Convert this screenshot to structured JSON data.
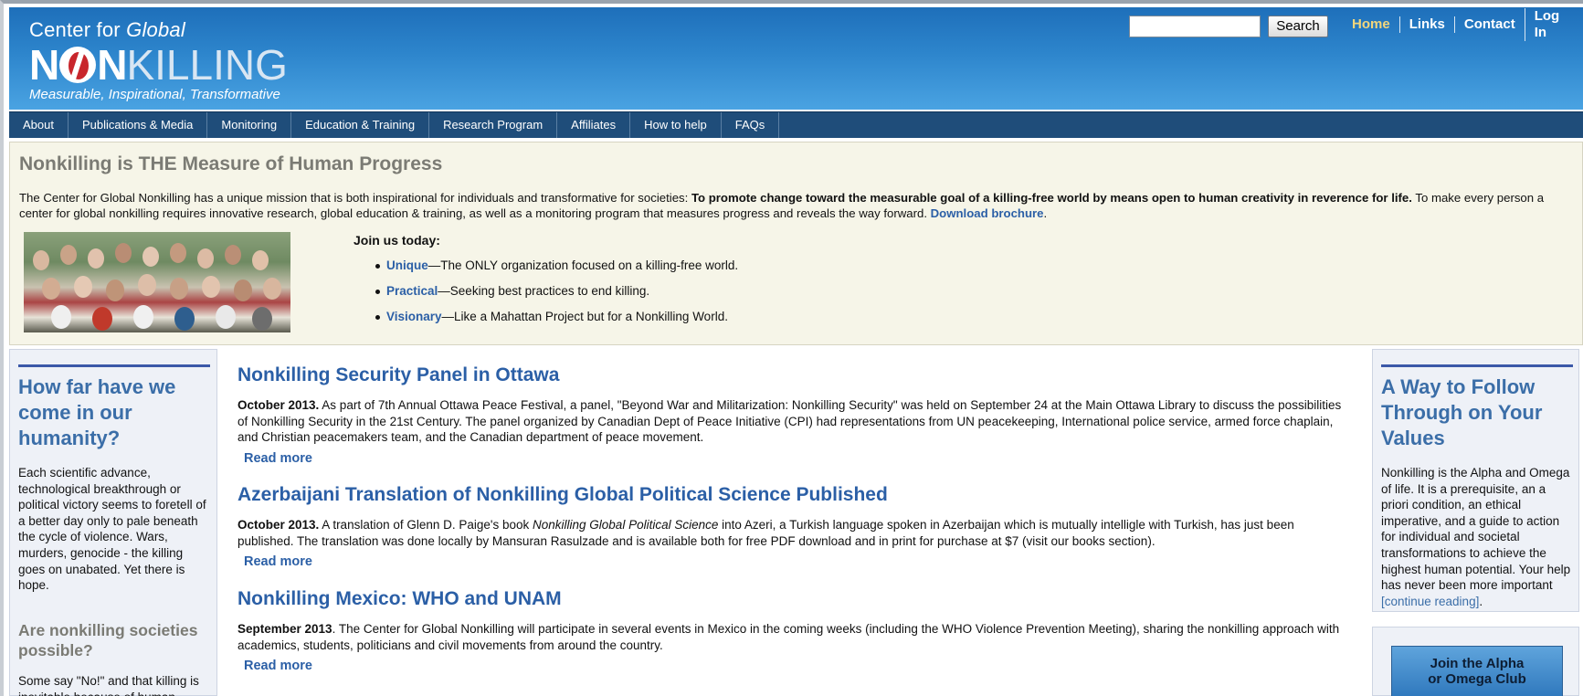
{
  "header": {
    "logo": {
      "top": "Center for ",
      "top_italic": "Global",
      "word_start": "N",
      "word_mid": "N",
      "word_end": "KILLING",
      "tagline": "Measurable, Inspirational, Transformative"
    },
    "search_button": "Search",
    "search_value": "",
    "links": [
      "Home",
      "Links",
      "Contact",
      "Log In"
    ]
  },
  "nav": [
    "About",
    "Publications & Media",
    "Monitoring",
    "Education & Training",
    "Research Program",
    "Affiliates",
    "How to help",
    "FAQs"
  ],
  "intro": {
    "title": "Nonkilling is THE Measure of Human Progress",
    "text_a": "The Center for Global Nonkilling has a unique mission that is both inspirational for individuals and transformative for societies: ",
    "text_bold": "To promote change toward the measurable goal of a killing-free world by means open to human creativity in reverence for life.",
    "text_b": " To make every person a center for global nonkilling requires innovative research, global education & training, as well as a monitoring program that measures progress and reveals the way forward. ",
    "brochure_link": "Download brochure",
    "text_end": ".",
    "join_title": "Join us today:",
    "join_items": [
      {
        "keyword": "Unique",
        "text": "—The ONLY organization focused on a killing-free world."
      },
      {
        "keyword": "Practical",
        "text": "—Seeking best practices to end killing."
      },
      {
        "keyword": "Visionary",
        "text": "—Like a Mahattan Project but for a Nonkilling World."
      }
    ]
  },
  "left": {
    "heading": "How far have we come in our humanity?",
    "paragraph": "Each scientific advance, technological breakthrough or political victory seems to foretell of a better day only to pale beneath the cycle of violence. Wars, murders, genocide - the killing goes on unabated. Yet there is hope.",
    "heading2": "Are nonkilling societies possible?",
    "paragraph2": "Some say \"No!\" and that killing is inevitable because of human"
  },
  "posts": [
    {
      "title": "Nonkilling Security Panel in Ottawa",
      "date": "October 2013.",
      "body": " As part of 7th Annual Ottawa Peace Festival, a panel, \"Beyond War and Militarization: Nonkilling Security\" was held on September 24 at the Main Ottawa Library to discuss the possibilities of Nonkilling Security in the 21st Century. The panel organized by Canadian Dept of Peace Initiative (CPI) had representations from UN peacekeeping, International police service, armed force chaplain, and Christian peacemakers team, and the Canadian department of peace movement.",
      "more": "Read more"
    },
    {
      "title": "Azerbaijani Translation of Nonkilling Global Political Science Published",
      "date": "October 2013.",
      "body_a": " A translation of Glenn D. Paige's book ",
      "body_italic": "Nonkilling Global Political Science",
      "body_b": " into Azeri, a Turkish language spoken in Azerbaijan which is mutually intelligle with Turkish, has just been published. The translation was done locally by Mansuran Rasulzade and is available both for free PDF download and in print for purchase at $7 (visit our books section).",
      "more": "Read more"
    },
    {
      "title": "Nonkilling Mexico: WHO and UNAM",
      "date": "September 2013",
      "body": ". The Center for Global Nonkilling will participate in several events in Mexico in the coming weeks (including the WHO Violence Prevention Meeting), sharing the nonkilling approach with academics, students, politicians and civil movements from around the country.",
      "more": "Read more"
    }
  ],
  "right": {
    "heading": "A Way to Follow Through on Your Values",
    "paragraph": "Nonkilling is the Alpha and Omega of life. It is a prerequisite, an a priori condition, an ethical imperative, and a guide to action for individual and societal transformations to achieve the highest human potential. Your help has never been more important ",
    "continue_link": "[continue reading]",
    "paragraph_end": ".",
    "club_line1": "Join the Alpha",
    "club_line2": "or Omega Club"
  },
  "colors": {
    "header_blue": "#2d85cc",
    "nav_blue": "#1f4d7a",
    "link_blue": "#2b5fa6",
    "intro_bg": "#f6f5e8",
    "home_link": "#f2d67c"
  }
}
